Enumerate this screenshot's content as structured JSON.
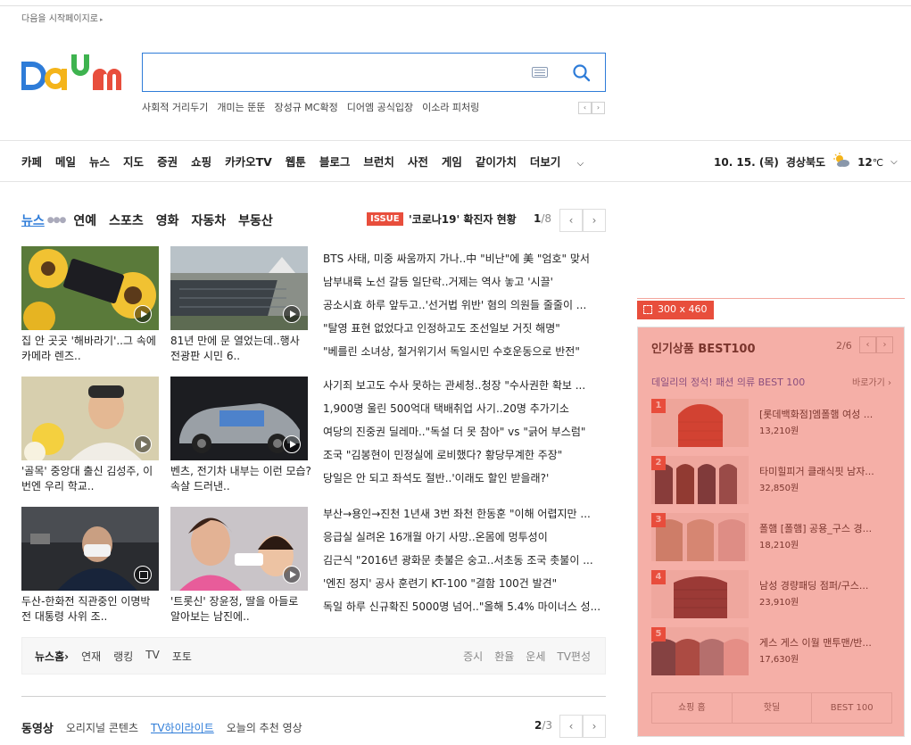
{
  "header": {
    "start_page": "다음을 시작페이지로",
    "trends": [
      "사회적 거리두기",
      "개미는 뚠뚠",
      "장성규 MC확정",
      "디어엠 공식입장",
      "이소라 피처링"
    ]
  },
  "gnb": {
    "items": [
      "카페",
      "메일",
      "뉴스",
      "지도",
      "증권",
      "쇼핑",
      "카카오TV",
      "웹툰",
      "블로그",
      "브런치",
      "사전",
      "게임",
      "같이가치",
      "더보기"
    ],
    "date": "10. 15. (목)",
    "region": "경상북도",
    "temp": "12",
    "temp_unit": "℃"
  },
  "news": {
    "tabs": [
      "뉴스",
      "연예",
      "스포츠",
      "영화",
      "자동차",
      "부동산"
    ],
    "issue_badge": "ISSUE",
    "issue_text": "'코로나19' 확진자 현황",
    "page_current": "1",
    "page_total": "/8",
    "cards": [
      {
        "caption": "집 안 곳곳 '해바라기'..그 속에 카메라 렌즈..",
        "icon": "play-icon"
      },
      {
        "caption": "81년 만에 문 열었는데..행사 전광판 시민 6..",
        "icon": "play-icon"
      },
      {
        "caption": "'골목' 중앙대 출신 김성주, 이번엔 우리 학교..",
        "icon": "play-icon"
      },
      {
        "caption": "벤츠, 전기차 내부는 이런 모습? 속살 드러낸..",
        "icon": "play-icon"
      },
      {
        "caption": "두산-한화전 직관중인 이명박 전 대통령 사위 조..",
        "icon": "photo-icon"
      },
      {
        "caption": "'트롯신' 장윤정, 딸을 아들로 알아보는 남진에..",
        "icon": "play-icon"
      }
    ],
    "headlines": [
      [
        "BTS 사태, 미중 싸움까지 가나..中 \"비난\"에 美 \"엄호\" 맞서",
        "남부내륙 노선 갈등 일단락..거제는 역사 놓고 '시끌'",
        "공소시효 하루 앞두고..'선거법 위반' 혐의 의원들 줄줄이 ...",
        "\"탈영 표현 없었다고 인정하고도 조선일보 거짓 해명\"",
        "\"베를린 소녀상, 철거위기서 독일시민 수호운동으로 반전\""
      ],
      [
        "사기죄 보고도 수사 못하는 관세청..청장 \"수사권한 확보 ...",
        "1,900명 울린 500억대 택배취업 사기..20명 추가기소",
        "여당의 진중권 딜레마..\"독설 더 못 참아\" vs \"긁어 부스럼\"",
        "조국 \"김봉현이 민정실에 로비했다? 황당무계한 주장\"",
        "당일은 안 되고 좌석도 절반..'이래도 할인 받을래?'"
      ],
      [
        "부산→용인→진천 1년새 3번 좌천 한동훈 \"이해 어렵지만 ...",
        "응급실 실려온 16개월 아기 사망..온몸에 멍투성이",
        "김근식 \"2016년 광화문 촛불은 숭고..서초동 조국 촛불이 ...",
        "'엔진 정지' 공사 훈련기 KT-100 \"결함 100건 발견\"",
        "독일 하루 신규확진 5000명 넘어..\"올해 5.4% 마이너스 성..."
      ]
    ],
    "footer_left": [
      "뉴스홈",
      "연재",
      "랭킹",
      "TV",
      "포토"
    ],
    "footer_right": [
      "증시",
      "환율",
      "운세",
      "TV편성"
    ]
  },
  "video": {
    "title": "동영상",
    "tabs": [
      "오리지널 콘텐츠",
      "TV하이라이트",
      "오늘의 추천 영상"
    ],
    "page_current": "2",
    "page_total": "/3"
  },
  "ad": {
    "size_label": "300 x 460"
  },
  "best": {
    "title": "인기상품 BEST100",
    "page": "2/6",
    "subtitle": "데일리의 정석! 패션 의류 BEST 100",
    "more": "바로가기",
    "items": [
      {
        "rank": "1",
        "name": "[롯데백화점]엠폴햄 여성 ...",
        "price": "13,210원",
        "color": "#c0392b"
      },
      {
        "rank": "2",
        "name": "타미힐피거 클래식핏 남자...",
        "price": "32,850원",
        "color": "#3a2f3a"
      },
      {
        "rank": "3",
        "name": "폴햄 [폴햄] 공용_구스 경...",
        "price": "18,210원",
        "color": "#b8a48c"
      },
      {
        "rank": "4",
        "name": "남성 경량패딩 점퍼/구스...",
        "price": "23,910원",
        "color": "#5b2a32"
      },
      {
        "rank": "5",
        "name": "게스 게스 이월 맨투맨/반...",
        "price": "17,630원",
        "color": "#333a48"
      }
    ],
    "tabs": [
      "쇼핑 홈",
      "핫딜",
      "BEST 100"
    ]
  },
  "colors": {
    "brand_blue": "#2e7cd8",
    "ad_red": "#e84e3c"
  }
}
